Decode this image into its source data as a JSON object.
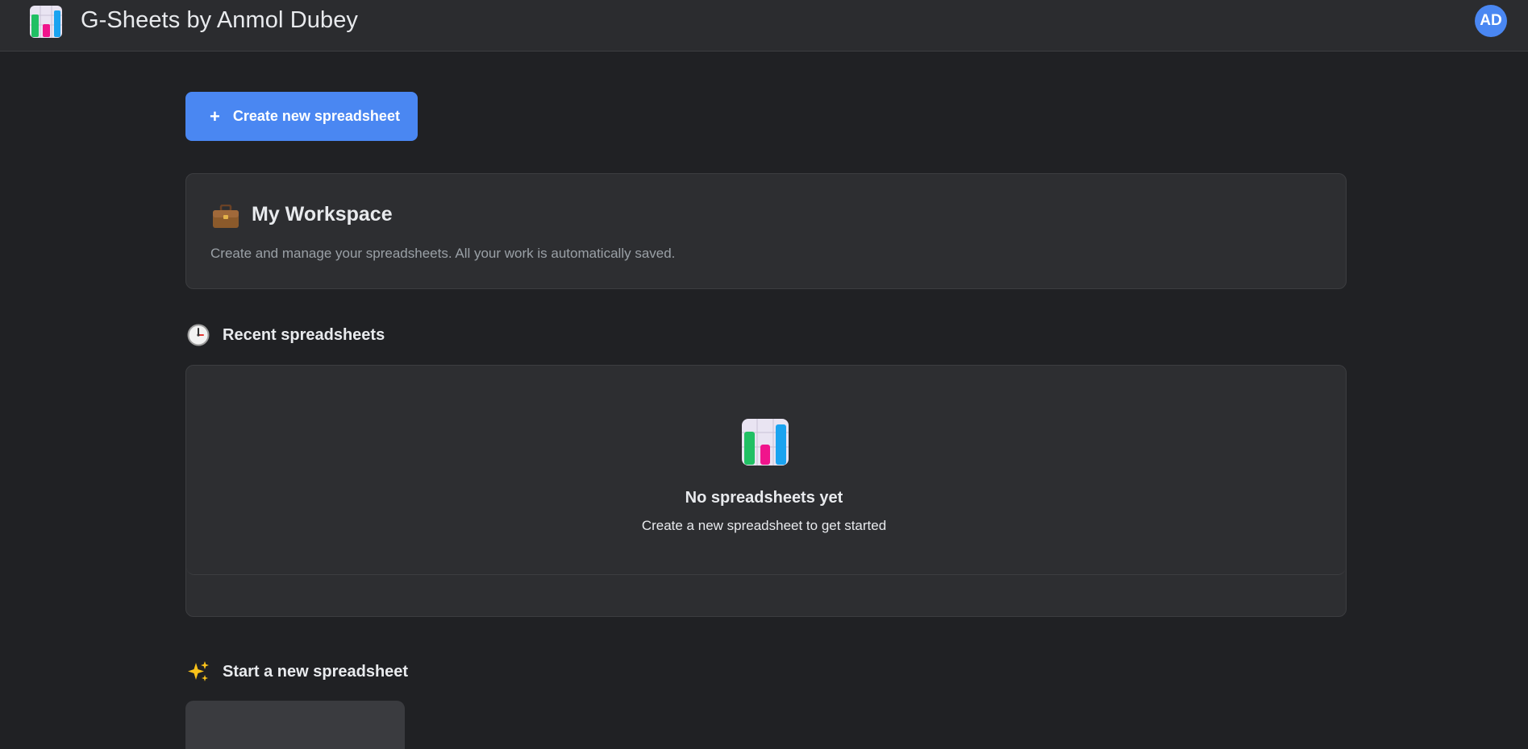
{
  "header": {
    "app_title": "G-Sheets by Anmol Dubey",
    "logo_icon": "spreadsheet-chart-icon",
    "avatar_initials": "AD",
    "avatar_color": "#4a87f2"
  },
  "actions": {
    "create_label": "Create new spreadsheet",
    "create_icon": "plus-icon",
    "accent_color": "#4a87f2"
  },
  "workspace": {
    "icon": "briefcase-icon",
    "title": "My Workspace",
    "description": "Create and manage your spreadsheets. All your work is automatically saved."
  },
  "recent": {
    "icon": "clock-icon",
    "heading": "Recent spreadsheets",
    "empty_icon": "spreadsheet-chart-icon",
    "empty_title": "No spreadsheets yet",
    "empty_description": "Create a new spreadsheet to get started"
  },
  "templates": {
    "icon": "sparkles-icon",
    "heading": "Start a new spreadsheet"
  }
}
